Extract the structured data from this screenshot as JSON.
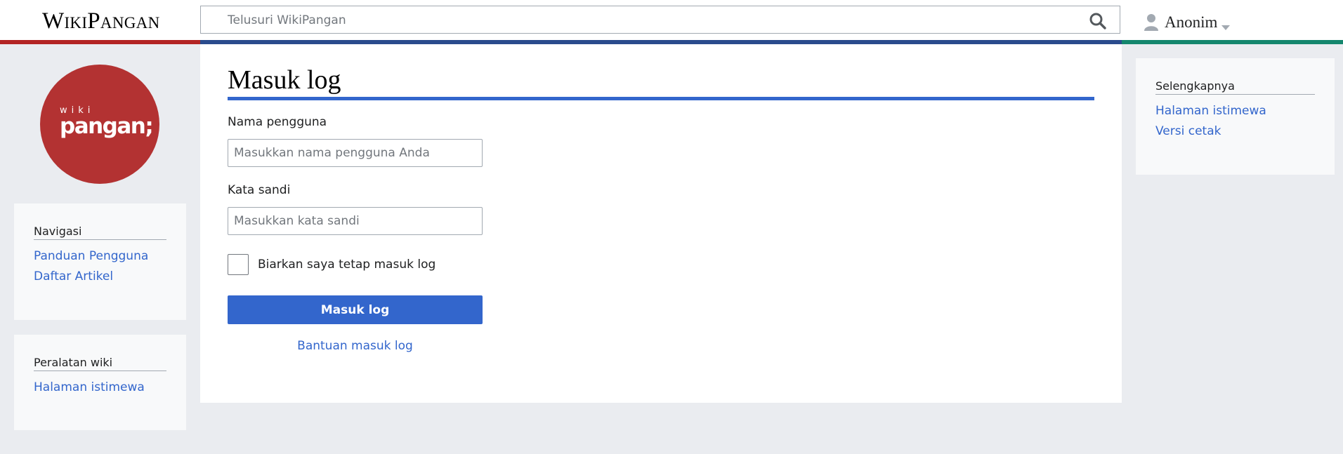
{
  "header": {
    "wordmark": "WikiPangan",
    "search_placeholder": "Telusuri WikiPangan",
    "search_icon": "search-icon",
    "user_name": "Anonim",
    "user_icon": "user-icon",
    "caret_icon": "chevron-down-icon"
  },
  "logo": {
    "top_text": "wiki",
    "main_text": "pangan;",
    "color": "#b33232"
  },
  "sidebar": {
    "navigation": {
      "heading": "Navigasi",
      "items": [
        "Panduan Pengguna",
        "Daftar Artikel"
      ]
    },
    "tools": {
      "heading": "Peralatan wiki",
      "items": [
        "Halaman istimewa"
      ]
    }
  },
  "more_menu": {
    "heading": "Selengkapnya",
    "items": [
      "Halaman istimewa",
      "Versi cetak"
    ]
  },
  "content": {
    "title": "Masuk log",
    "username_label": "Nama pengguna",
    "username_placeholder": "Masukkan nama pengguna Anda",
    "username_value": "",
    "password_label": "Kata sandi",
    "password_placeholder": "Masukkan kata sandi",
    "password_value": "",
    "remember_label": "Biarkan saya tetap masuk log",
    "remember_checked": false,
    "submit_label": "Masuk log",
    "help_link": "Bantuan masuk log"
  },
  "colors": {
    "accent": "#3366cc",
    "stripe_red": "#b32424",
    "stripe_blue": "#2a4b8d",
    "stripe_green": "#14866d"
  }
}
